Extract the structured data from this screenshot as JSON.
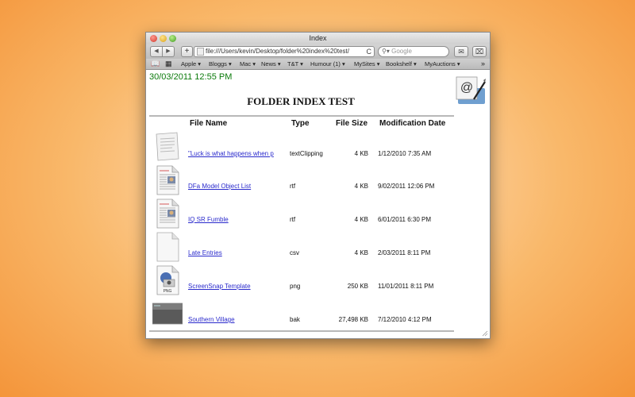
{
  "window": {
    "title": "Index"
  },
  "toolbar": {
    "back": "◀",
    "forward": "▶",
    "add": "+",
    "url": "file:///Users/kevin/Desktop/folder%20index%20test/",
    "reload": "C",
    "search_placeholder": "Google"
  },
  "bookmarks": [
    "Apple ▾",
    "Bloggs ▾",
    "Mac ▾",
    "News ▾",
    "T&T ▾",
    "Humour (1) ▾",
    "MySites ▾",
    "Bookshelf ▾",
    "MyAuctions ▾"
  ],
  "page": {
    "datetime": "30/03/2011 12:55 PM",
    "title": "FOLDER INDEX TEST",
    "columns": [
      "File Size",
      "File Name",
      "Type",
      "Modification Date"
    ],
    "headers": {
      "name": "File Name",
      "type": "Type",
      "size": "File Size",
      "date": "Modification Date"
    },
    "files": [
      {
        "name": "\"Luck is what happens when p",
        "type": "textClipping",
        "size": "4 KB",
        "date": "1/12/2010 7:35 AM",
        "icon": "text-clipping-icon"
      },
      {
        "name": "DFa Model Object List",
        "type": "rtf",
        "size": "4 KB",
        "date": "9/02/2011 12:06 PM",
        "icon": "rtf-document-icon"
      },
      {
        "name": "IQ SR Fumble",
        "type": "rtf",
        "size": "4 KB",
        "date": "6/01/2011 6:30 PM",
        "icon": "rtf-document-icon"
      },
      {
        "name": "Late Entries",
        "type": "csv",
        "size": "4 KB",
        "date": "2/03/2011 8:11 PM",
        "icon": "blank-document-icon"
      },
      {
        "name": "ScreenSnap Template",
        "type": "png",
        "size": "250 KB",
        "date": "11/01/2011 8:11 PM",
        "icon": "png-image-icon"
      },
      {
        "name": "Southern Village",
        "type": "bak",
        "size": "27,498 KB",
        "date": "7/12/2010 4:12 PM",
        "icon": "image-thumbnail-icon"
      }
    ],
    "png_label": "PNG"
  }
}
